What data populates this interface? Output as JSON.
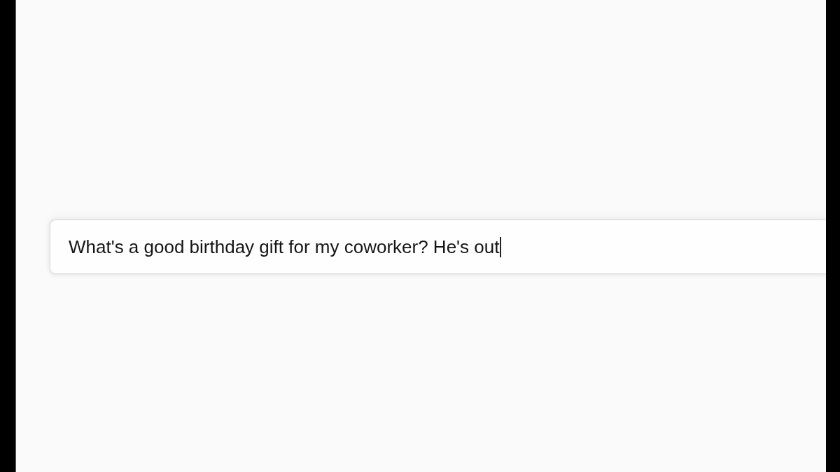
{
  "prompt_field": {
    "value": "What's a good birthday gift for my coworker? He's out",
    "focused": true
  }
}
